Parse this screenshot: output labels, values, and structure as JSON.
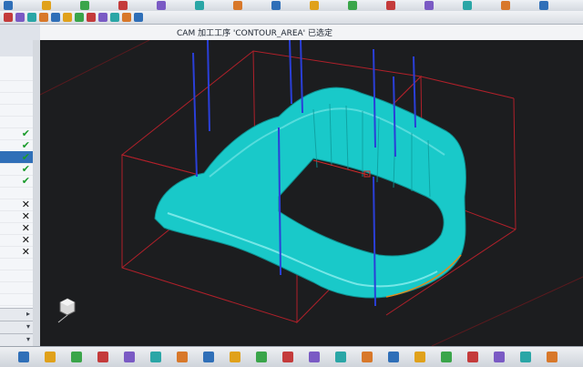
{
  "viewport": {
    "title": "CAM 加工工序 'CONTOUR_AREA' 已选定"
  },
  "operation_navigator": {
    "rows": [
      {
        "status": "",
        "selected": false
      },
      {
        "status": "",
        "selected": false
      },
      {
        "status": "",
        "selected": false
      },
      {
        "status": "",
        "selected": false
      },
      {
        "status": "",
        "selected": false
      },
      {
        "status": "✔",
        "state": "ok",
        "selected": false
      },
      {
        "status": "✔",
        "state": "ok",
        "selected": false
      },
      {
        "status": "✔",
        "state": "ok",
        "selected": true
      },
      {
        "status": "✔",
        "state": "ok",
        "selected": false
      },
      {
        "status": "✔",
        "state": "ok",
        "selected": false
      },
      {
        "status": "",
        "selected": false
      },
      {
        "status": "✕",
        "state": "bad",
        "selected": false
      },
      {
        "status": "✕",
        "state": "bad",
        "selected": false
      },
      {
        "status": "✕",
        "state": "bad",
        "selected": false
      },
      {
        "status": "✕",
        "state": "bad",
        "selected": false
      },
      {
        "status": "✕",
        "state": "bad",
        "selected": false
      },
      {
        "status": "",
        "selected": false
      },
      {
        "status": "",
        "selected": false
      },
      {
        "status": "",
        "selected": false
      },
      {
        "status": "",
        "selected": false
      }
    ],
    "colors": {
      "selected": "#2f6fb8",
      "ok": "#1a9b2b",
      "bad": "#111111"
    }
  },
  "model": {
    "part_color": "#19c9c9",
    "box_color": "#b0202a",
    "tool_axis_color": "#2a3fd8"
  },
  "toolbar_top_icons": [
    "arrow-icon",
    "help-icon",
    "cut-icon",
    "paste-icon",
    "scissors-icon",
    "view-icon",
    "layer-icon",
    "zoom-icon",
    "check-icon",
    "plus-icon",
    "minus-icon",
    "grid-icon",
    "report-icon",
    "sheet-icon",
    "settings-icon"
  ],
  "toolbar_bottom_icons": [
    "snap-icon",
    "cross-icon",
    "move-icon",
    "cut-icon",
    "wcs-icon",
    "mcs-icon",
    "view-front-icon",
    "view-top-icon",
    "view-right-icon",
    "view-left-icon",
    "view-back-icon",
    "view-iso-icon",
    "view-bottom-icon",
    "tool-path-icon",
    "verify-icon",
    "simulate-icon",
    "measure-icon",
    "render-icon",
    "shade-icon",
    "clip-icon",
    "close-icon"
  ]
}
